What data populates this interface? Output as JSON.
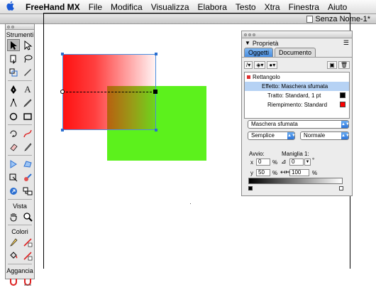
{
  "menubar": {
    "apple": "",
    "items": [
      "FreeHand MX",
      "File",
      "Modifica",
      "Visualizza",
      "Elabora",
      "Testo",
      "Xtra",
      "Finestra",
      "Aiuto"
    ]
  },
  "document": {
    "title": "Senza Nome-1*"
  },
  "tools_panel": {
    "title": "Strumenti",
    "sections": {
      "vista": "Vista",
      "colori": "Colori",
      "aggancia": "Aggancia"
    }
  },
  "properties": {
    "title": "Proprietà",
    "tabs": [
      "Oggetti",
      "Documento"
    ],
    "attributes": [
      {
        "label": "Rettangolo"
      },
      {
        "label": "Effetto: Maschera sfumata"
      },
      {
        "label": "Tratto: Standard, 1 pt"
      },
      {
        "label": "Riempimento: Standard"
      }
    ],
    "effect_popup": "Maschera sfumata",
    "type_popup": "Semplice",
    "mode_popup": "Normale",
    "avvio_label": "Avvio:",
    "maniglia_label": "Maniglia 1:",
    "x_label": "x",
    "x_value": "0",
    "y_label": "y",
    "y_value": "50",
    "pct": "%",
    "angle_value": "0",
    "degree": "°",
    "length_value": "100",
    "colors": {
      "stroke_swatch": "#000000",
      "fill_swatch": "#ff0000",
      "accent": "#4a8ee0"
    }
  }
}
